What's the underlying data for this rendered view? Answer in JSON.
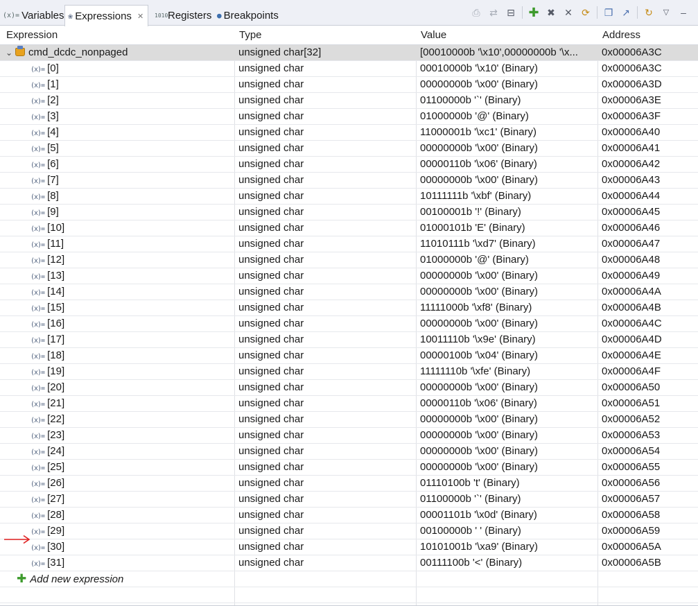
{
  "tabs": [
    {
      "icon": "(x)=",
      "label": "Variables"
    },
    {
      "icon": "❀",
      "label": "Expressions",
      "close": "✕"
    },
    {
      "icon": "1010",
      "label": "Registers"
    },
    {
      "icon": "●",
      "label": "Breakpoints"
    }
  ],
  "columns": [
    "Expression",
    "Type",
    "Value",
    "Address"
  ],
  "parent": {
    "name": "cmd_dcdc_nonpaged",
    "type": "unsigned char[32]",
    "value": "[00010000b '\\x10',00000000b '\\x...",
    "address": "0x00006A3C"
  },
  "rows": [
    {
      "name": "[0]",
      "type": "unsigned char",
      "value": "00010000b '\\x10' (Binary)",
      "address": "0x00006A3C"
    },
    {
      "name": "[1]",
      "type": "unsigned char",
      "value": "00000000b '\\x00' (Binary)",
      "address": "0x00006A3D"
    },
    {
      "name": "[2]",
      "type": "unsigned char",
      "value": "01100000b '`' (Binary)",
      "address": "0x00006A3E"
    },
    {
      "name": "[3]",
      "type": "unsigned char",
      "value": "01000000b '@' (Binary)",
      "address": "0x00006A3F"
    },
    {
      "name": "[4]",
      "type": "unsigned char",
      "value": "11000001b '\\xc1' (Binary)",
      "address": "0x00006A40"
    },
    {
      "name": "[5]",
      "type": "unsigned char",
      "value": "00000000b '\\x00' (Binary)",
      "address": "0x00006A41"
    },
    {
      "name": "[6]",
      "type": "unsigned char",
      "value": "00000110b '\\x06' (Binary)",
      "address": "0x00006A42"
    },
    {
      "name": "[7]",
      "type": "unsigned char",
      "value": "00000000b '\\x00' (Binary)",
      "address": "0x00006A43"
    },
    {
      "name": "[8]",
      "type": "unsigned char",
      "value": "10111111b '\\xbf' (Binary)",
      "address": "0x00006A44"
    },
    {
      "name": "[9]",
      "type": "unsigned char",
      "value": "00100001b '!' (Binary)",
      "address": "0x00006A45"
    },
    {
      "name": "[10]",
      "type": "unsigned char",
      "value": "01000101b 'E' (Binary)",
      "address": "0x00006A46"
    },
    {
      "name": "[11]",
      "type": "unsigned char",
      "value": "11010111b '\\xd7' (Binary)",
      "address": "0x00006A47"
    },
    {
      "name": "[12]",
      "type": "unsigned char",
      "value": "01000000b '@' (Binary)",
      "address": "0x00006A48"
    },
    {
      "name": "[13]",
      "type": "unsigned char",
      "value": "00000000b '\\x00' (Binary)",
      "address": "0x00006A49"
    },
    {
      "name": "[14]",
      "type": "unsigned char",
      "value": "00000000b '\\x00' (Binary)",
      "address": "0x00006A4A"
    },
    {
      "name": "[15]",
      "type": "unsigned char",
      "value": "11111000b '\\xf8' (Binary)",
      "address": "0x00006A4B"
    },
    {
      "name": "[16]",
      "type": "unsigned char",
      "value": "00000000b '\\x00' (Binary)",
      "address": "0x00006A4C"
    },
    {
      "name": "[17]",
      "type": "unsigned char",
      "value": "10011110b '\\x9e' (Binary)",
      "address": "0x00006A4D"
    },
    {
      "name": "[18]",
      "type": "unsigned char",
      "value": "00000100b '\\x04' (Binary)",
      "address": "0x00006A4E"
    },
    {
      "name": "[19]",
      "type": "unsigned char",
      "value": "11111110b '\\xfe' (Binary)",
      "address": "0x00006A4F"
    },
    {
      "name": "[20]",
      "type": "unsigned char",
      "value": "00000000b '\\x00' (Binary)",
      "address": "0x00006A50"
    },
    {
      "name": "[21]",
      "type": "unsigned char",
      "value": "00000110b '\\x06' (Binary)",
      "address": "0x00006A51"
    },
    {
      "name": "[22]",
      "type": "unsigned char",
      "value": "00000000b '\\x00' (Binary)",
      "address": "0x00006A52"
    },
    {
      "name": "[23]",
      "type": "unsigned char",
      "value": "00000000b '\\x00' (Binary)",
      "address": "0x00006A53"
    },
    {
      "name": "[24]",
      "type": "unsigned char",
      "value": "00000000b '\\x00' (Binary)",
      "address": "0x00006A54"
    },
    {
      "name": "[25]",
      "type": "unsigned char",
      "value": "00000000b '\\x00' (Binary)",
      "address": "0x00006A55"
    },
    {
      "name": "[26]",
      "type": "unsigned char",
      "value": "01110100b 't' (Binary)",
      "address": "0x00006A56"
    },
    {
      "name": "[27]",
      "type": "unsigned char",
      "value": "01100000b '`' (Binary)",
      "address": "0x00006A57"
    },
    {
      "name": "[28]",
      "type": "unsigned char",
      "value": "00001101b '\\x0d' (Binary)",
      "address": "0x00006A58"
    },
    {
      "name": "[29]",
      "type": "unsigned char",
      "value": "00100000b ' ' (Binary)",
      "address": "0x00006A59"
    },
    {
      "name": "[30]",
      "type": "unsigned char",
      "value": "10101001b '\\xa9' (Binary)",
      "address": "0x00006A5A"
    },
    {
      "name": "[31]",
      "type": "unsigned char",
      "value": "00111100b '<' (Binary)",
      "address": "0x00006A5B"
    }
  ],
  "add_expression_label": "Add new expression",
  "icons": {
    "variable": "(x)=",
    "expand": "⌄",
    "add": "✚"
  },
  "colors": {
    "selected_row": "#dcdcdc",
    "annotation_arrow": "#e02020",
    "add_icon": "#3d9a2c"
  }
}
